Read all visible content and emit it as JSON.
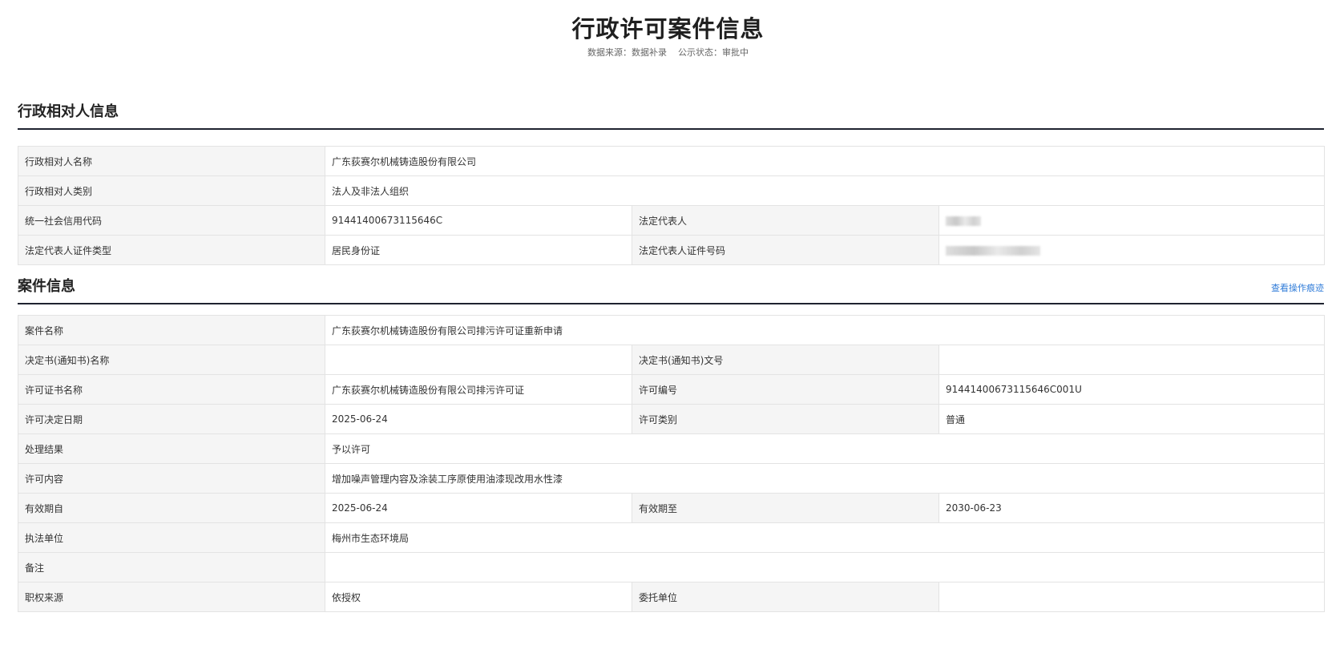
{
  "page": {
    "title": "行政许可案件信息",
    "data_source": "数据来源：数据补录",
    "publicity_status": "公示状态：审批中"
  },
  "party_section": {
    "title": "行政相对人信息",
    "rows": {
      "name_label": "行政相对人名称",
      "name_value": "广东荻赛尔机械铸造股份有限公司",
      "type_label": "行政相对人类别",
      "type_value": "法人及非法人组织",
      "credit_code_label": "统一社会信用代码",
      "credit_code_value": "91441400673115646C",
      "legal_rep_label": "法定代表人",
      "legal_rep_id_type_label": "法定代表人证件类型",
      "legal_rep_id_type_value": "居民身份证",
      "legal_rep_id_number_label": "法定代表人证件号码"
    }
  },
  "case_section": {
    "title": "案件信息",
    "link_label": "查看操作痕迹",
    "rows": {
      "case_name_label": "案件名称",
      "case_name_value": "广东荻赛尔机械铸造股份有限公司排污许可证重新申请",
      "decision_name_label": "决定书(通知书)名称",
      "decision_name_value": "",
      "decision_number_label": "决定书(通知书)文号",
      "decision_number_value": "",
      "license_name_label": "许可证书名称",
      "license_name_value": "广东荻赛尔机械铸造股份有限公司排污许可证",
      "license_number_label": "许可编号",
      "license_number_value": "91441400673115646C001U",
      "decision_date_label": "许可决定日期",
      "decision_date_value": "2025-06-24",
      "license_category_label": "许可类别",
      "license_category_value": "普通",
      "result_label": "处理结果",
      "result_value": "予以许可",
      "content_label": "许可内容",
      "content_value": "增加噪声管理内容及涂装工序原使用油漆现改用水性漆",
      "valid_from_label": "有效期自",
      "valid_from_value": "2025-06-24",
      "valid_to_label": "有效期至",
      "valid_to_value": "2030-06-23",
      "enforcement_unit_label": "执法单位",
      "enforcement_unit_value": "梅州市生态环境局",
      "remarks_label": "备注",
      "remarks_value": "",
      "authority_source_label": "职权来源",
      "authority_source_value": "依授权",
      "entrusted_unit_label": "委托单位",
      "entrusted_unit_value": ""
    }
  }
}
